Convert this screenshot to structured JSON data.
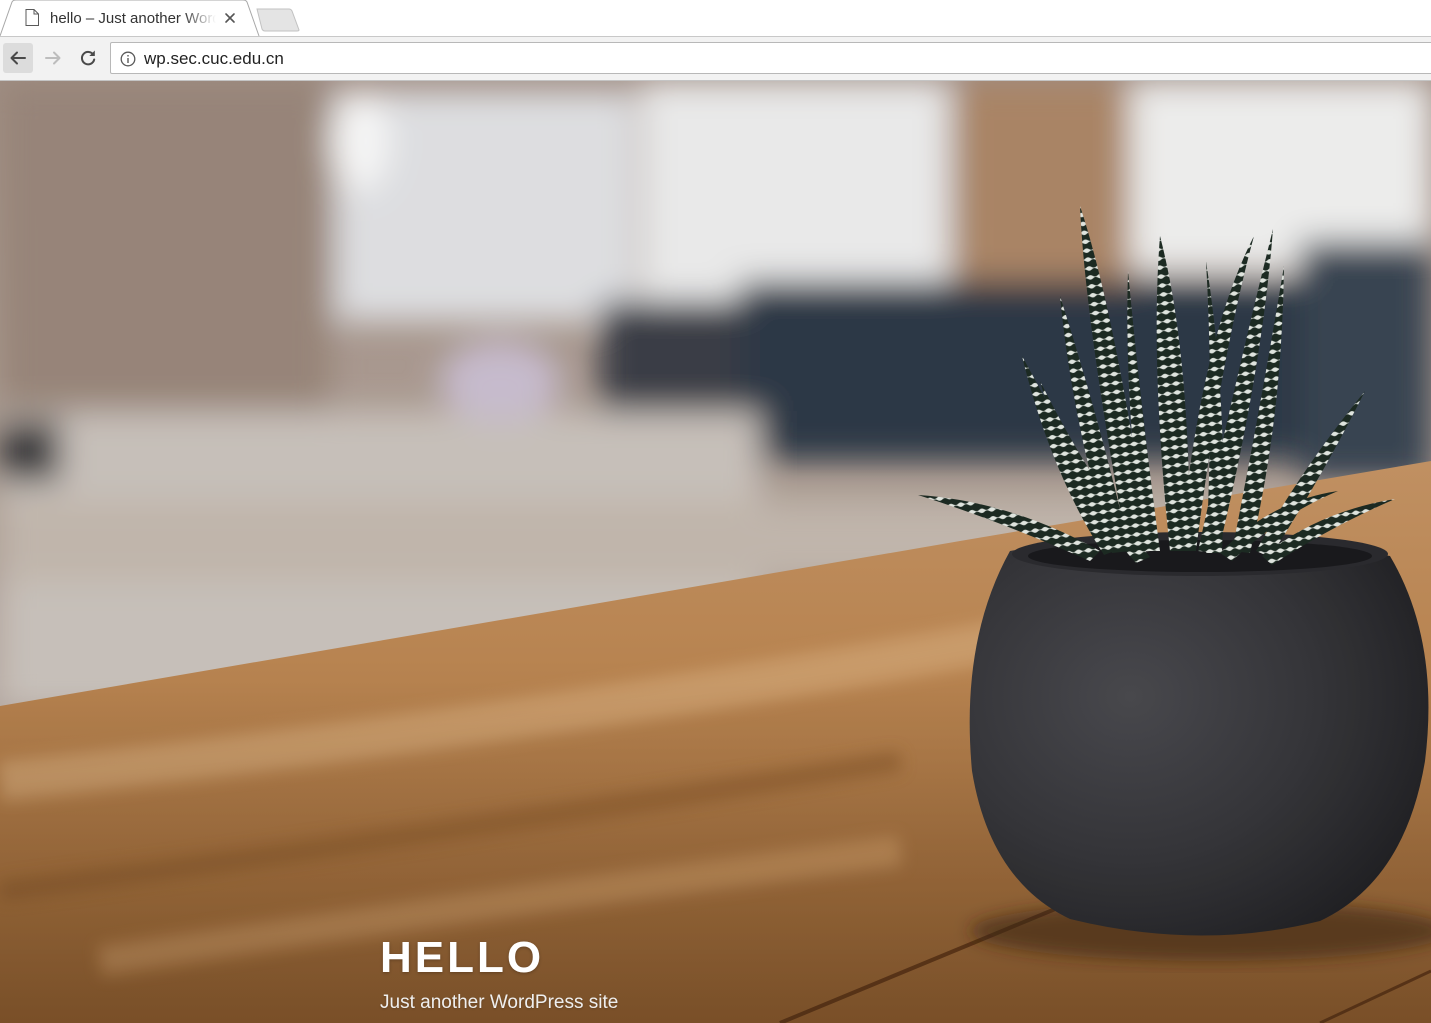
{
  "browser": {
    "tab": {
      "title": "hello – Just another WordPress site"
    },
    "address_bar": {
      "url": "wp.sec.cuc.edu.cn"
    },
    "icons": [
      "page-icon",
      "close-icon",
      "back-arrow-icon",
      "forward-arrow-icon",
      "reload-icon",
      "info-icon"
    ]
  },
  "page": {
    "site_title": "HELLO",
    "site_description": "Just another WordPress site",
    "header_image": "photo of a striped succulent in a dark grey pot on a wooden table"
  }
}
